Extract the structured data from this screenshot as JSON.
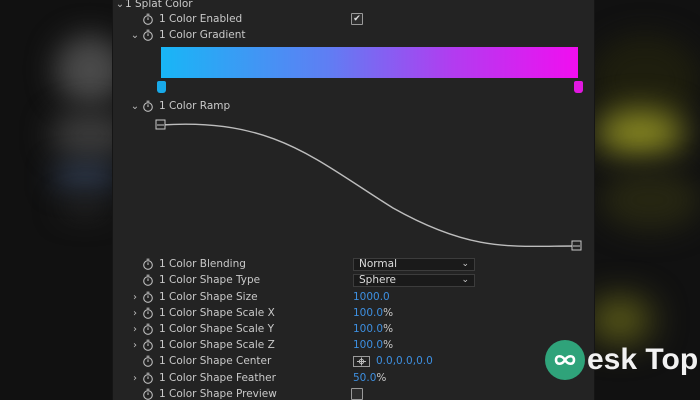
{
  "section": {
    "label": "1 Splat Color"
  },
  "rows": {
    "enabled": {
      "label": "1 Color Enabled",
      "checked": true
    },
    "gradient": {
      "label": "1 Color Gradient",
      "start_color": "#18b6f6",
      "end_color": "#f10ef0"
    },
    "ramp": {
      "label": "1 Color Ramp"
    },
    "blending": {
      "label": "1 Color Blending",
      "value": "Normal"
    },
    "shape_type": {
      "label": "1 Color Shape Type",
      "value": "Sphere"
    },
    "shape_size": {
      "label": "1 Color Shape Size",
      "value": "1000.0"
    },
    "scale_x": {
      "label": "1 Color Shape Scale X",
      "value": "100.0",
      "unit": "%"
    },
    "scale_y": {
      "label": "1 Color Shape Scale Y",
      "value": "100.0",
      "unit": "%"
    },
    "scale_z": {
      "label": "1 Color Shape Scale Z",
      "value": "100.0",
      "unit": "%"
    },
    "center": {
      "label": "1 Color Shape Center",
      "value": "0.0,0.0,0.0"
    },
    "feather": {
      "label": "1 Color Shape Feather",
      "value": "50.0",
      "unit": "%"
    },
    "preview": {
      "label": "1 Color Shape Preview",
      "checked": false
    }
  },
  "watermark": {
    "text": "esk Top",
    "glyph": "∞"
  },
  "colors": {
    "accent_blue": "#3d8fe0",
    "panel": "#232323"
  }
}
